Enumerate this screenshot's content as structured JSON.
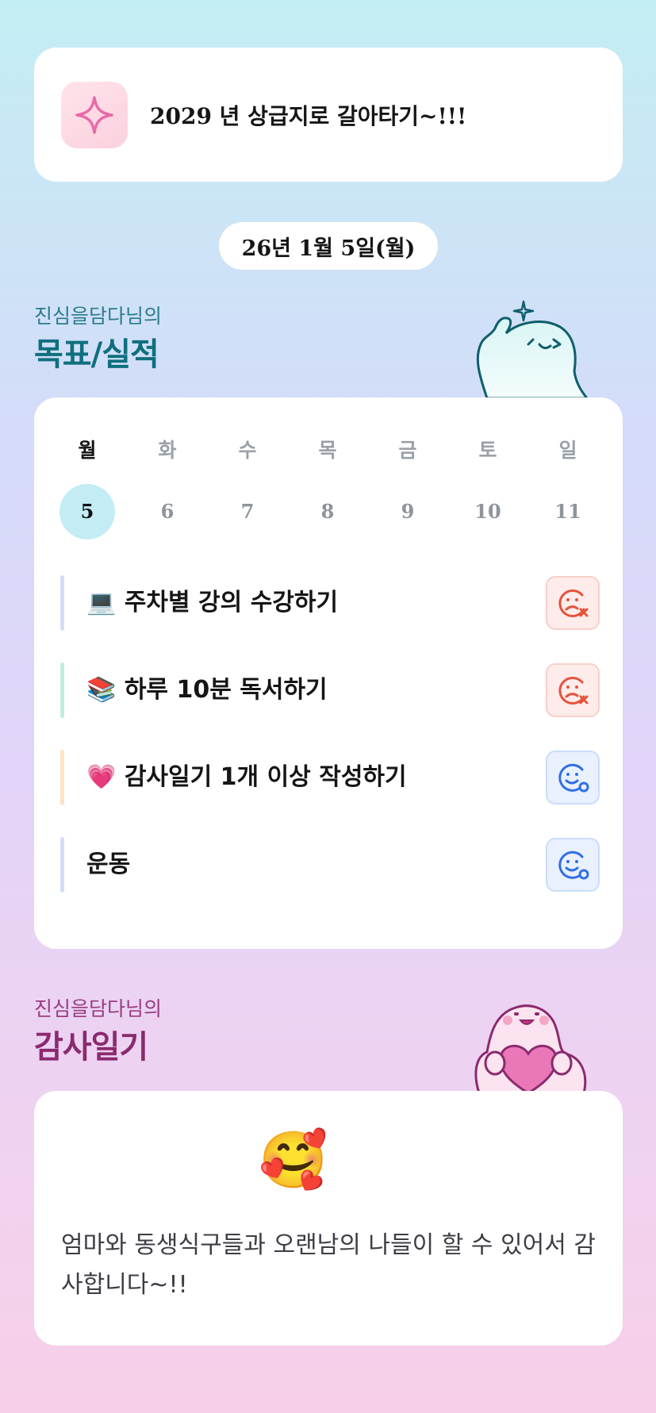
{
  "goal": {
    "text": "2029 년 상급지로 갈아타기~!!!",
    "icon": "sparkle-icon"
  },
  "date_label": "26년 1월 5일(월)",
  "goals_section": {
    "subtitle": "진심을담다님의",
    "title": "목표/실적"
  },
  "week": {
    "days": [
      {
        "label": "월",
        "num": "5",
        "active": true
      },
      {
        "label": "화",
        "num": "6",
        "active": false
      },
      {
        "label": "수",
        "num": "7",
        "active": false
      },
      {
        "label": "목",
        "num": "8",
        "active": false
      },
      {
        "label": "금",
        "num": "9",
        "active": false
      },
      {
        "label": "토",
        "num": "10",
        "active": false
      },
      {
        "label": "일",
        "num": "11",
        "active": false
      }
    ]
  },
  "tasks": [
    {
      "emoji": "💻",
      "label": "주차별 강의 수강하기",
      "bar_color": "#d3ddf7",
      "status": "fail",
      "status_icon": "sad-face-x-icon"
    },
    {
      "emoji": "📚",
      "label": "하루 10분 독서하기",
      "bar_color": "#bfeedd",
      "status": "fail",
      "status_icon": "sad-face-x-icon"
    },
    {
      "emoji": "💗",
      "label": "감사일기 1개 이상 작성하기",
      "bar_color": "#fde3c4",
      "status": "ok",
      "status_icon": "smile-face-check-icon"
    },
    {
      "emoji": "",
      "label": "운동",
      "bar_color": "#d3ddf7",
      "status": "ok",
      "status_icon": "smile-face-check-icon"
    }
  ],
  "diary_section": {
    "subtitle": "진심을담다님의",
    "title": "감사일기"
  },
  "diary": {
    "emoji": "🥰",
    "text": "엄마와 동생식구들과 오랜남의 나들이 할 수 있어서 감사합니다~!!"
  },
  "colors": {
    "teal": "#0f6f7e",
    "plum": "#8a2a6e",
    "fail_red": "#e5533d",
    "ok_blue": "#2f6fe6"
  }
}
